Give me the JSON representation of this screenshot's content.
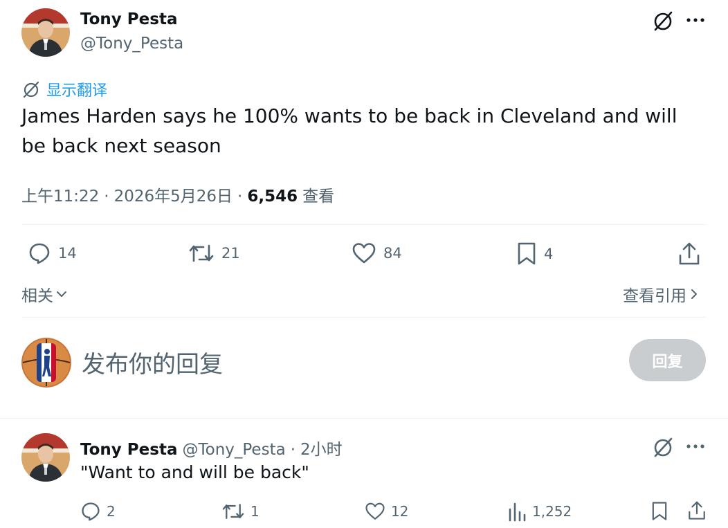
{
  "tweet": {
    "author_name": "Tony Pesta",
    "author_handle": "@Tony_Pesta",
    "translate_label": "显示翻译",
    "text": "James Harden says he 100% wants to be back in Cleveland and will be back next season",
    "time": "上午11:22",
    "date": "2026年5月26日",
    "sep": "·",
    "views_count": "6,546",
    "views_label": "查看",
    "replies": "14",
    "retweets": "21",
    "likes": "84",
    "bookmarks": "4"
  },
  "related": {
    "label": "相关",
    "quotes_label": "查看引用"
  },
  "composer": {
    "placeholder": "发布你的回复",
    "reply_button": "回复"
  },
  "reply": {
    "author_name": "Tony Pesta",
    "author_handle": "@Tony_Pesta",
    "sep": "·",
    "time": "2小时",
    "text": "\"Want to and will be back\"",
    "replies": "2",
    "retweets": "1",
    "likes": "12",
    "views": "1,252"
  },
  "colors": {
    "text": "#0f1419",
    "muted": "#536471",
    "link": "#1d9bf0",
    "divider": "#eff3f4",
    "reply_button_disabled": "#c9cdd0"
  },
  "icons": [
    "grok-icon",
    "more-icon",
    "translate-icon",
    "reply-icon",
    "retweet-icon",
    "like-icon",
    "bookmark-icon",
    "share-icon",
    "chevron-down-icon",
    "chevron-right-icon",
    "views-icon"
  ]
}
